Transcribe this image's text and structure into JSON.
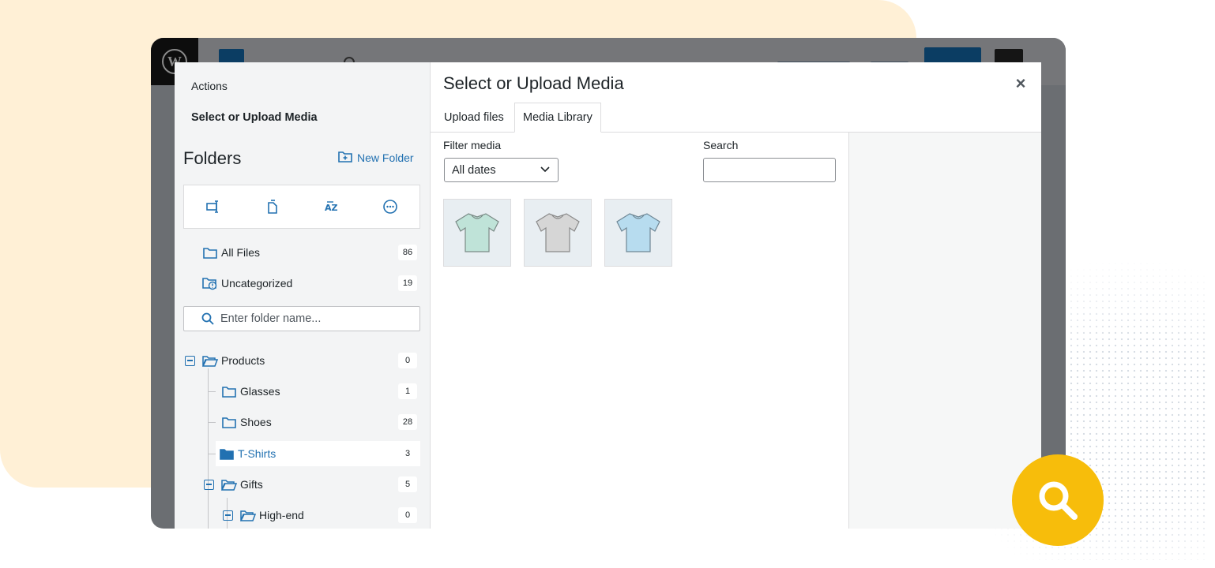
{
  "modal": {
    "actions_label": "Actions",
    "side_title": "Select or Upload Media",
    "title": "Select or Upload Media",
    "close_symbol": "×"
  },
  "folders": {
    "heading": "Folders",
    "new_folder_label": "New Folder",
    "toolbar_icons": [
      "rename-icon",
      "duplicate-icon",
      "sort-az-icon",
      "more-options-icon"
    ],
    "all_files": {
      "label": "All Files",
      "count": "86"
    },
    "uncategorized": {
      "label": "Uncategorized",
      "count": "19"
    },
    "search_placeholder": "Enter folder name...",
    "tree": {
      "products": {
        "label": "Products",
        "count": "0"
      },
      "glasses": {
        "label": "Glasses",
        "count": "1"
      },
      "shoes": {
        "label": "Shoes",
        "count": "28"
      },
      "tshirts": {
        "label": "T-Shirts",
        "count": "3"
      },
      "gifts": {
        "label": "Gifts",
        "count": "5"
      },
      "highend": {
        "label": "High-end",
        "count": "0"
      }
    }
  },
  "tabs": {
    "upload": "Upload files",
    "library": "Media Library",
    "active": "Media Library"
  },
  "filter": {
    "label": "Filter media",
    "selected": "All dates"
  },
  "search": {
    "label": "Search",
    "value": ""
  },
  "media": [
    {
      "name": "mint-tshirt",
      "color": "#bfe3d8"
    },
    {
      "name": "grey-tshirt",
      "color": "#d6d6d6"
    },
    {
      "name": "blue-tshirt",
      "color": "#b7dcef"
    }
  ],
  "colors": {
    "accent": "#2271b1",
    "fab": "#f7bd0b",
    "blob": "#fff0d6"
  }
}
